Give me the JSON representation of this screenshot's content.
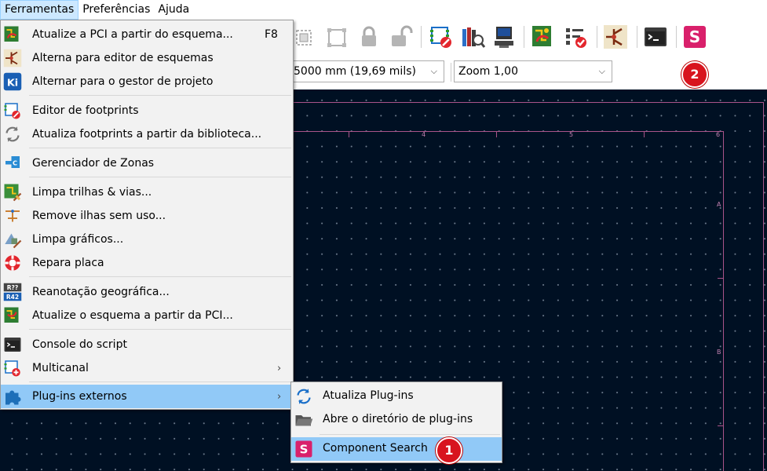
{
  "menubar": {
    "items": [
      {
        "label": "Ferramentas",
        "active": true
      },
      {
        "label": "Preferências",
        "active": false
      },
      {
        "label": "Ajuda",
        "active": false
      }
    ]
  },
  "selectors": {
    "grid_value": "5000 mm (19,69 mils)",
    "zoom_value": "Zoom 1,00"
  },
  "frame": {
    "col_labels": [
      "4",
      "5",
      "6"
    ],
    "row_labels": [
      "A",
      "B"
    ]
  },
  "main_menu": {
    "items": [
      {
        "label": "Atualize a PCI a partir do esquema...",
        "shortcut": "F8",
        "icon": "update-pcb-icon"
      },
      {
        "label": "Alterna para editor de esquemas",
        "icon": "schematic-editor-icon"
      },
      {
        "label": "Alternar para o gestor de projeto",
        "icon": "kicad-manager-icon"
      },
      {
        "label": "Editor de footprints",
        "icon": "footprint-editor-icon"
      },
      {
        "label": "Atualiza footprints a partir da biblioteca...",
        "icon": "refresh-footprints-icon"
      },
      {
        "label": "Gerenciador de Zonas",
        "icon": "zone-manager-icon"
      },
      {
        "label": "Limpa trilhas & vias...",
        "icon": "cleanup-tracks-icon"
      },
      {
        "label": "Remove ilhas sem uso...",
        "icon": "remove-islands-icon"
      },
      {
        "label": "Limpa gráficos...",
        "icon": "cleanup-graphics-icon"
      },
      {
        "label": "Repara placa",
        "icon": "repair-board-icon"
      },
      {
        "label": "Reanotação geográfica...",
        "icon": "reannotate-icon"
      },
      {
        "label": "Atualize o esquema a partir da PCI...",
        "icon": "update-schematic-icon"
      },
      {
        "label": "Console do script",
        "icon": "script-console-icon"
      },
      {
        "label": "Multicanal",
        "icon": "multichannel-icon",
        "submenu": true
      },
      {
        "label": "Plug-ins externos",
        "icon": "plugin-puzzle-icon",
        "submenu": true
      }
    ]
  },
  "sub_menu": {
    "items": [
      {
        "label": "Atualiza Plug-ins",
        "icon": "refresh-plugins-icon"
      },
      {
        "label": "Abre o diretório de plug-ins",
        "icon": "folder-open-icon"
      },
      {
        "label": "Component Search",
        "icon": "component-search-icon"
      }
    ]
  },
  "badges": {
    "one": "1",
    "two": "2"
  },
  "colors": {
    "canvas_bg": "#001023",
    "frame_line": "#a8548a",
    "menu_highlight": "#91c9f7",
    "badge_red": "#d8141e",
    "plugin_pink": "#d9206b"
  }
}
